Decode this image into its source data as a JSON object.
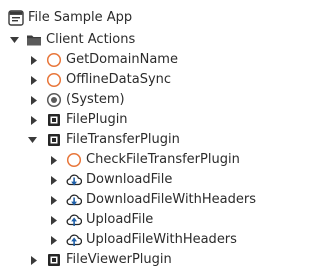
{
  "tree": {
    "app": {
      "label": "File Sample App",
      "expanded": true
    },
    "client_actions": {
      "label": "Client Actions",
      "expanded": true
    },
    "get_domain_name": {
      "label": "GetDomainName"
    },
    "offline_data_sync": {
      "label": "OfflineDataSync"
    },
    "system": {
      "label": "(System)",
      "expanded": false
    },
    "file_plugin": {
      "label": "FilePlugin",
      "expanded": false
    },
    "file_transfer_plugin": {
      "label": "FileTransferPlugin",
      "expanded": true
    },
    "check_file_transfer_plugin": {
      "label": "CheckFileTransferPlugin"
    },
    "download_file": {
      "label": "DownloadFile"
    },
    "download_file_with_headers": {
      "label": "DownloadFileWithHeaders"
    },
    "upload_file": {
      "label": "UploadFile"
    },
    "upload_file_with_headers": {
      "label": "UploadFileWithHeaders"
    },
    "file_viewer_plugin": {
      "label": "FileViewerPlugin",
      "expanded": false
    }
  },
  "colors": {
    "text": "#2b2b2b",
    "arrow": "#3a3a3a",
    "folder": "#3c3c3c",
    "client_action_circle": "#e8763a",
    "system_circle": "#5a5a5a",
    "cloud": "#1e5fa8",
    "module_box": "#262626"
  },
  "icons": {
    "app": "application-icon",
    "client_actions": "folder-icon",
    "client_action": "client-action-icon",
    "system": "system-module-icon",
    "plugin": "plugin-module-icon",
    "download": "cloud-download-icon",
    "upload": "cloud-upload-icon"
  }
}
